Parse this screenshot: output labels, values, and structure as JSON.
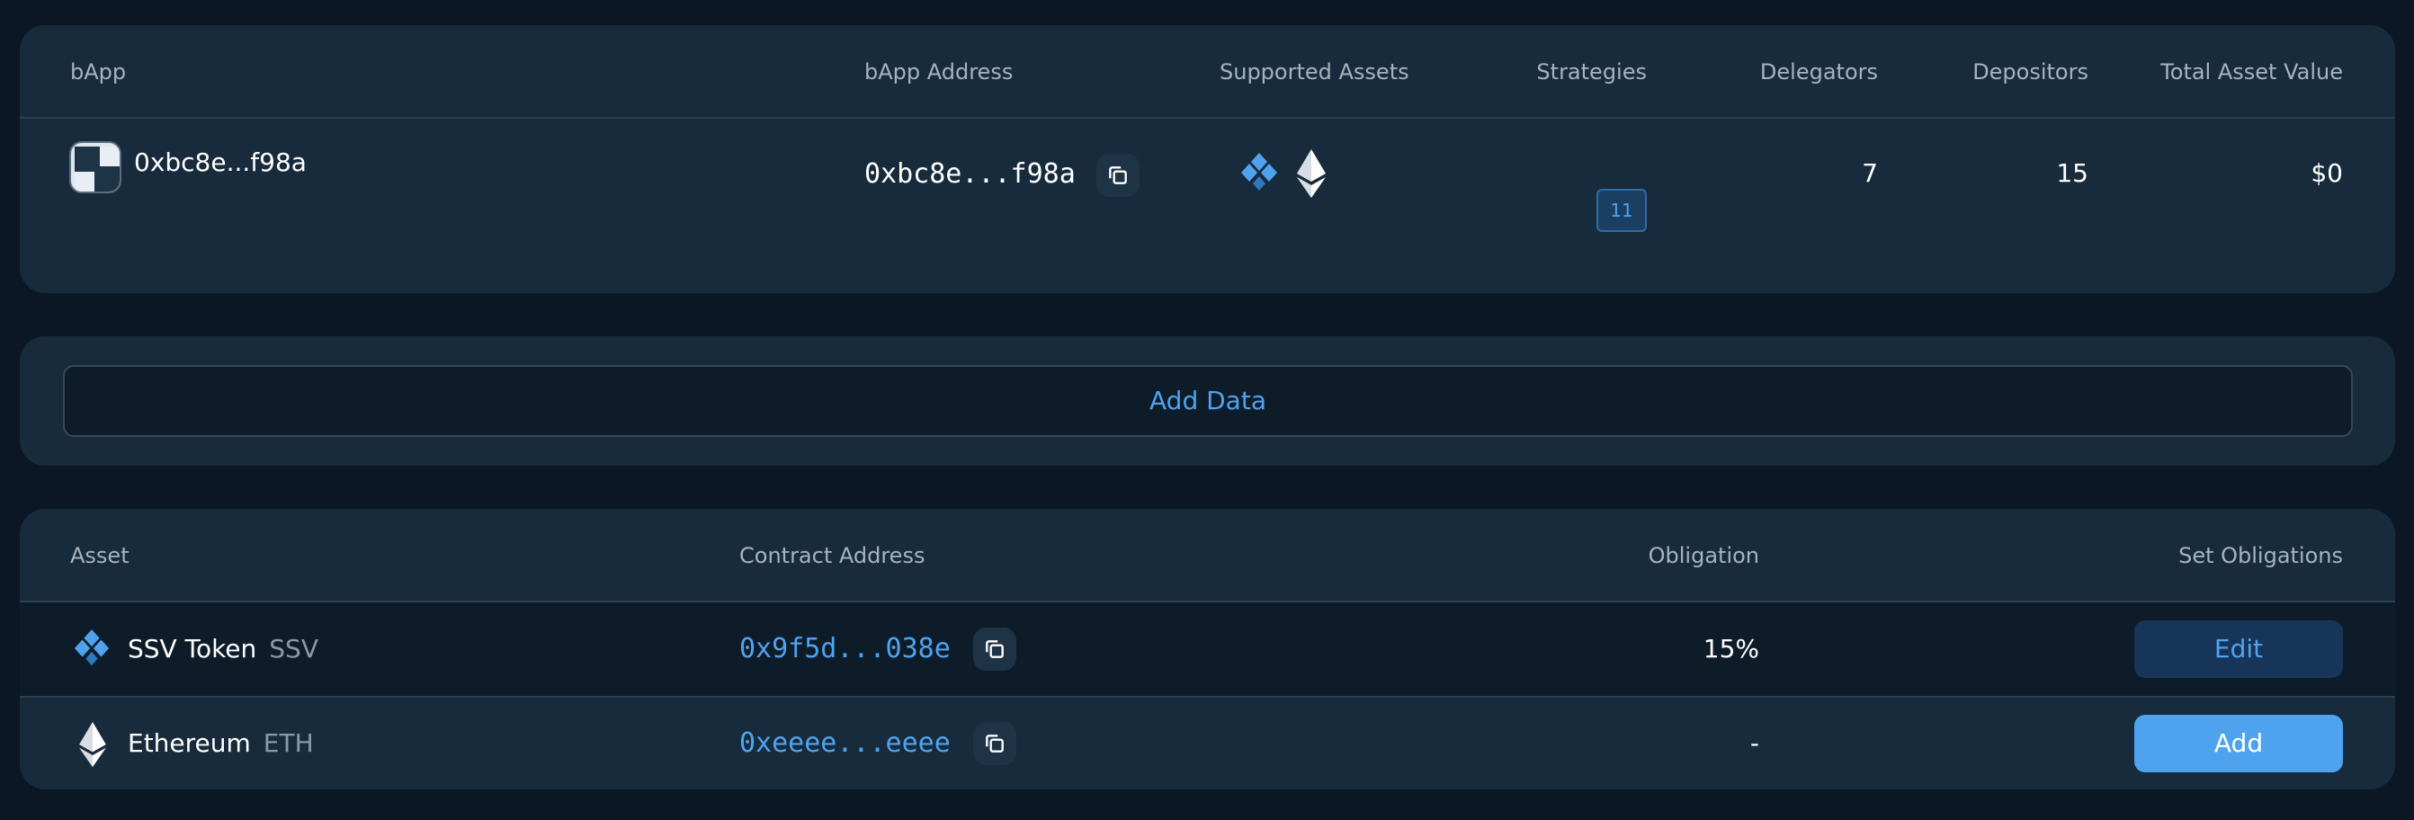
{
  "bapp_table": {
    "headers": {
      "bapp": "bApp",
      "address": "bApp Address",
      "assets": "Supported Assets",
      "strategies": "Strategies",
      "delegators": "Delegators",
      "depositors": "Depositors",
      "total_value": "Total Asset Value"
    },
    "row": {
      "name": "0xbc8e...f98a",
      "address": "0xbc8e...f98a",
      "supported_assets": [
        "ssv-icon",
        "ethereum-icon"
      ],
      "strategies": "11",
      "delegators": "7",
      "depositors": "15",
      "total_value": "$0"
    }
  },
  "add_data": {
    "label": "Add Data"
  },
  "assets_table": {
    "headers": {
      "asset": "Asset",
      "contract": "Contract Address",
      "obligation": "Obligation",
      "set": "Set Obligations"
    },
    "rows": [
      {
        "name": "SSV Token",
        "symbol": "SSV",
        "icon": "ssv-icon",
        "contract": "0x9f5d...038e",
        "obligation": "15%",
        "action": "Edit"
      },
      {
        "name": "Ethereum",
        "symbol": "ETH",
        "icon": "ethereum-icon",
        "contract": "0xeeee...eeee",
        "obligation": "-",
        "action": "Add"
      }
    ]
  },
  "colors": {
    "page_bg": "#0b1724",
    "card_bg": "#182b3c",
    "accent": "#4fa3ee",
    "header_text": "#a6b3bf"
  }
}
